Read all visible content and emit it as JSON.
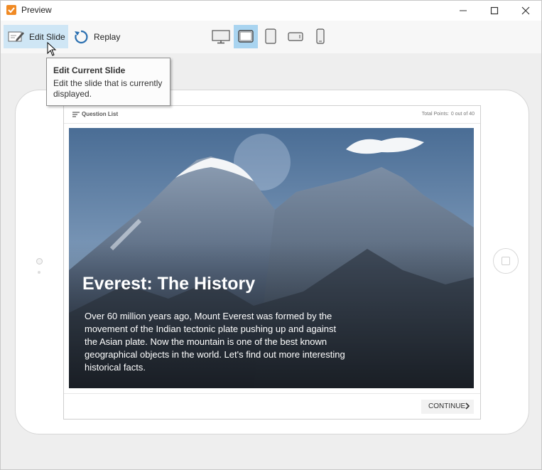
{
  "window": {
    "title": "Preview"
  },
  "toolbar": {
    "edit_label": "Edit Slide",
    "replay_label": "Replay",
    "devices": [
      "desktop-icon",
      "tablet-landscape-icon",
      "tablet-portrait-icon",
      "phone-landscape-icon",
      "phone-portrait-icon"
    ],
    "active_device": "tablet-landscape-icon"
  },
  "tooltip": {
    "title": "Edit Current Slide",
    "body": "Edit the slide that is currently displayed."
  },
  "slide": {
    "question_list_label": "Question List",
    "points_label": "Total Points:",
    "points_value": "0 out of 40",
    "hero_title": "Everest: The History",
    "hero_body": "Over 60 million years ago, Mount Everest was formed by the movement of the Indian tectonic plate pushing up and against the Asian plate. Now the mountain is one of the best known geographical objects in the world. Let's find out more interesting historical facts.",
    "continue_label": "CONTINUE"
  },
  "colors": {
    "accent": "#a9d4f0",
    "edit_highlight": "#cfe6f5",
    "app_icon": "#f08a24"
  }
}
